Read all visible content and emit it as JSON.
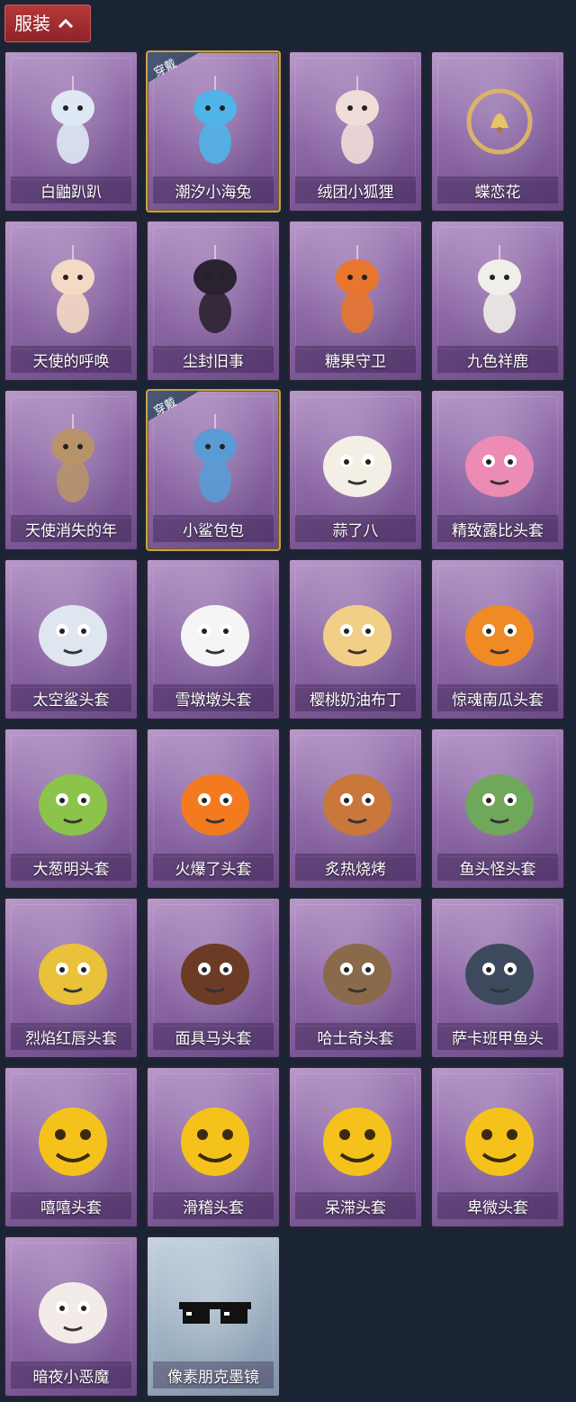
{
  "header": {
    "title": "服装",
    "expand_icon": "chevron-up-icon"
  },
  "badge_text": "穿戴",
  "items": [
    {
      "name": "白鼬趴趴",
      "equipped": false,
      "art": "white-ferret-icon",
      "color": "#dfe8f5"
    },
    {
      "name": "潮汐小海兔",
      "equipped": true,
      "art": "blue-sea-bunny-icon",
      "color": "#4fb4e8"
    },
    {
      "name": "绒团小狐狸",
      "equipped": false,
      "art": "fox-plush-icon",
      "color": "#f1ddd8"
    },
    {
      "name": "蝶恋花",
      "equipped": false,
      "art": "bell-wreath-icon",
      "color": "#d9b36a"
    },
    {
      "name": "天使的呼唤",
      "equipped": false,
      "art": "angel-doll-icon",
      "color": "#f4d9c4"
    },
    {
      "name": "尘封旧事",
      "equipped": false,
      "art": "dark-doll-icon",
      "color": "#2a2230"
    },
    {
      "name": "糖果守卫",
      "equipped": false,
      "art": "pumpkin-guard-icon",
      "color": "#e8762e"
    },
    {
      "name": "九色祥鹿",
      "equipped": false,
      "art": "deer-icon",
      "color": "#f0eee8"
    },
    {
      "name": "天使消失的年",
      "equipped": false,
      "art": "veiled-doll-icon",
      "color": "#b8936a"
    },
    {
      "name": "小鲨包包",
      "equipped": true,
      "art": "shark-bag-icon",
      "color": "#5a9bd6"
    },
    {
      "name": "蒜了八",
      "equipped": false,
      "art": "garlic-icon",
      "color": "#f3efe4"
    },
    {
      "name": "精致露比头套",
      "equipped": false,
      "art": "pink-beaver-icon",
      "color": "#ec8bb3"
    },
    {
      "name": "太空鲨头套",
      "equipped": false,
      "art": "space-shark-icon",
      "color": "#dfe6f0"
    },
    {
      "name": "雪墩墩头套",
      "equipped": false,
      "art": "snowman-icon",
      "color": "#f5f5f5"
    },
    {
      "name": "樱桃奶油布丁",
      "equipped": false,
      "art": "pudding-icon",
      "color": "#f2cf86"
    },
    {
      "name": "惊魂南瓜头套",
      "equipped": false,
      "art": "pumpkin-icon",
      "color": "#f08a24"
    },
    {
      "name": "大葱明头套",
      "equipped": false,
      "art": "scallion-icon",
      "color": "#8cc34a"
    },
    {
      "name": "火爆了头套",
      "equipped": false,
      "art": "fire-icon",
      "color": "#f47a1f"
    },
    {
      "name": "炙热烧烤",
      "equipped": false,
      "art": "barbecue-icon",
      "color": "#c9773a"
    },
    {
      "name": "鱼头怪头套",
      "equipped": false,
      "art": "fish-head-icon",
      "color": "#6fa85a"
    },
    {
      "name": "烈焰红唇头套",
      "equipped": false,
      "art": "yellow-mask-icon",
      "color": "#e9c13a"
    },
    {
      "name": "面具马头套",
      "equipped": false,
      "art": "horse-head-icon",
      "color": "#6b3b26"
    },
    {
      "name": "哈士奇头套",
      "equipped": false,
      "art": "husky-head-icon",
      "color": "#8a6a4a"
    },
    {
      "name": "萨卡班甲鱼头",
      "equipped": false,
      "art": "armored-fish-icon",
      "color": "#3d4a5e"
    },
    {
      "name": "嘻嘻头套",
      "equipped": false,
      "art": "grin-emoji-icon",
      "color": "#f5c21b"
    },
    {
      "name": "滑稽头套",
      "equipped": false,
      "art": "funny-emoji-icon",
      "color": "#f5c21b"
    },
    {
      "name": "呆滞头套",
      "equipped": false,
      "art": "dazed-emoji-icon",
      "color": "#f5c21b"
    },
    {
      "name": "卑微头套",
      "equipped": false,
      "art": "humble-emoji-icon",
      "color": "#f5c21b"
    },
    {
      "name": "暗夜小恶魔",
      "equipped": false,
      "art": "devil-mask-icon",
      "color": "#f3ebe8"
    },
    {
      "name": "像素朋克墨镜",
      "equipped": false,
      "art": "pixel-sunglasses-icon",
      "color": "#111111",
      "card_style": "blue"
    }
  ]
}
